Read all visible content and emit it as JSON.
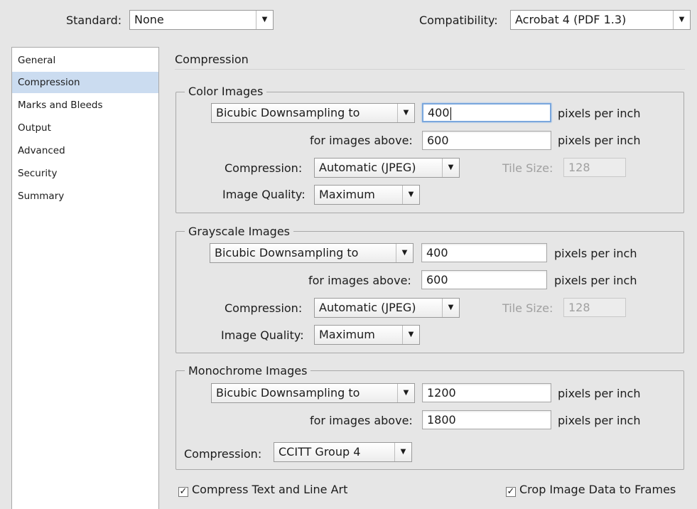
{
  "header": {
    "standard_label": "Standard:",
    "standard_value": "None",
    "compatibility_label": "Compatibility:",
    "compatibility_value": "Acrobat 4 (PDF 1.3)"
  },
  "sidebar": {
    "items": [
      {
        "label": "General"
      },
      {
        "label": "Compression",
        "selected": true
      },
      {
        "label": "Marks and Bleeds"
      },
      {
        "label": "Output"
      },
      {
        "label": "Advanced"
      },
      {
        "label": "Security"
      },
      {
        "label": "Summary"
      }
    ]
  },
  "panel": {
    "title": "Compression"
  },
  "color_images": {
    "title": "Color Images",
    "downsampling": "Bicubic Downsampling to",
    "ppi_value": "400",
    "ppi_unit": "pixels per inch",
    "above_label": "for images above:",
    "above_value": "600",
    "above_unit": "pixels per inch",
    "compression_label": "Compression:",
    "compression_value": "Automatic (JPEG)",
    "tile_label": "Tile Size:",
    "tile_value": "128",
    "quality_label": "Image Quality:",
    "quality_value": "Maximum"
  },
  "grayscale_images": {
    "title": "Grayscale Images",
    "downsampling": "Bicubic Downsampling to",
    "ppi_value": "400",
    "ppi_unit": "pixels per inch",
    "above_label": "for images above:",
    "above_value": "600",
    "above_unit": "pixels per inch",
    "compression_label": "Compression:",
    "compression_value": "Automatic (JPEG)",
    "tile_label": "Tile Size:",
    "tile_value": "128",
    "quality_label": "Image Quality:",
    "quality_value": "Maximum"
  },
  "monochrome_images": {
    "title": "Monochrome Images",
    "downsampling": "Bicubic Downsampling to",
    "ppi_value": "1200",
    "ppi_unit": "pixels per inch",
    "above_label": "for images above:",
    "above_value": "1800",
    "above_unit": "pixels per inch",
    "compression_label": "Compression:",
    "compression_value": "CCITT Group 4"
  },
  "options": {
    "compress_text_label": "Compress Text and Line Art",
    "compress_text_checked": true,
    "crop_image_label": "Crop Image Data to Frames",
    "crop_image_checked": true
  },
  "icons": {
    "dropdown_arrow": "▼",
    "checkmark": "✓"
  }
}
